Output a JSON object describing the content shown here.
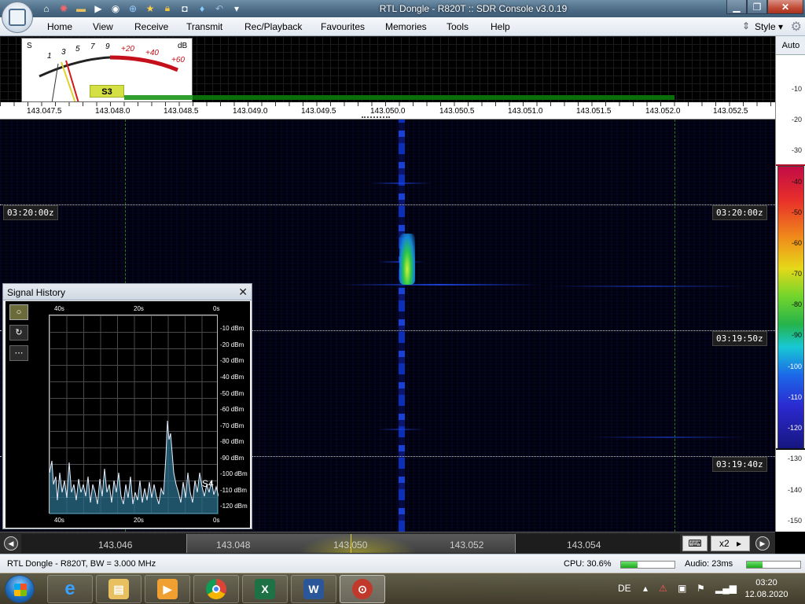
{
  "window": {
    "title": "RTL Dongle - R820T :: SDR Console v3.0.19"
  },
  "quick_access": [
    "home-icon",
    "lifebuoy-icon",
    "folder-icon",
    "play-icon",
    "stop-icon",
    "add-icon",
    "star-icon",
    "lock-icon",
    "camera-icon",
    "drop-icon",
    "undo-icon",
    "dropdown-icon"
  ],
  "menu": {
    "items": [
      "Home",
      "View",
      "Receive",
      "Transmit",
      "Rec/Playback",
      "Favourites",
      "Memories",
      "Tools",
      "Help"
    ],
    "style_label": "Style"
  },
  "smeter": {
    "s_label": "S",
    "db_label": "dB",
    "scale": [
      "1",
      "3",
      "5",
      "7",
      "9",
      "+20",
      "+40",
      "+60"
    ],
    "reading": "S3"
  },
  "frequency_scale": [
    "143.047.5",
    "143.048.0",
    "143.048.5",
    "143.049.0",
    "143.049.5",
    "143.050.0",
    "143.050.5",
    "143.051.0",
    "143.051.5",
    "143.052.0",
    "143.052.5"
  ],
  "waterfall": {
    "time_markers": [
      "03:20:00z",
      "03:19:50z",
      "03:19:40z"
    ]
  },
  "db_scale": {
    "auto_label": "Auto",
    "labels": [
      "-10",
      "-20",
      "-30",
      "-40",
      "-50",
      "-60",
      "-70",
      "-80",
      "-90",
      "-100",
      "-110",
      "-120",
      "-130",
      "-140",
      "-150"
    ]
  },
  "signal_history": {
    "title": "Signal History",
    "time_top": [
      "40s",
      "20s",
      "0s"
    ],
    "time_bottom": [
      "40s",
      "20s",
      "0s"
    ],
    "dbm_labels": [
      "-10 dBm",
      "-20 dBm",
      "-30 dBm",
      "-40 dBm",
      "-50 dBm",
      "-60 dBm",
      "-70 dBm",
      "-80 dBm",
      "-90 dBm",
      "-100 dBm",
      "-110 dBm",
      "-120 dBm"
    ],
    "s_reading": "S4",
    "tool_buttons": [
      "○",
      "↻",
      "⋯"
    ]
  },
  "tuning_bar": {
    "labels": [
      "143.046",
      "143.048",
      "143.050",
      "143.052",
      "143.054"
    ],
    "zoom": "x2"
  },
  "status": {
    "device": "RTL Dongle - R820T, BW = 3.000 MHz",
    "cpu": "CPU: 30.6%",
    "cpu_fraction": 0.306,
    "audio": "Audio: 23ms",
    "audio_fraction": 0.3
  },
  "taskbar": {
    "apps": [
      "internet-explorer-icon",
      "file-explorer-icon",
      "media-player-icon",
      "chrome-icon",
      "excel-icon",
      "word-icon",
      "sdr-console-icon"
    ],
    "language": "DE",
    "time": "03:20",
    "date": "12.08.2020"
  }
}
